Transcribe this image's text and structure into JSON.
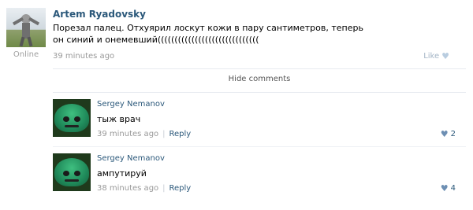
{
  "post": {
    "author": "Artem Ryadovsky",
    "status": "Online",
    "text": "Порезал палец. Отхуярил лоскут кожи в пару сантиметров, теперь он синий и онемевший((((((((((((((((((((((((((((((",
    "time": "39 minutes ago",
    "like_label": "Like"
  },
  "hide_comments_label": "Hide comments",
  "comments": [
    {
      "author": "Sergey Nemanov",
      "text": "тыж врач",
      "time": "39 minutes ago",
      "separator": "|",
      "reply_label": "Reply",
      "likes": "2"
    },
    {
      "author": "Sergey Nemanov",
      "text": "ампутируй",
      "time": "38 minutes ago",
      "separator": "|",
      "reply_label": "Reply",
      "likes": "4"
    }
  ],
  "colors": {
    "link": "#2b587a",
    "muted": "#999999",
    "heart_inactive": "#b9cde0",
    "heart_active": "#6d8fb3"
  },
  "icons": {
    "like": "heart-icon"
  }
}
